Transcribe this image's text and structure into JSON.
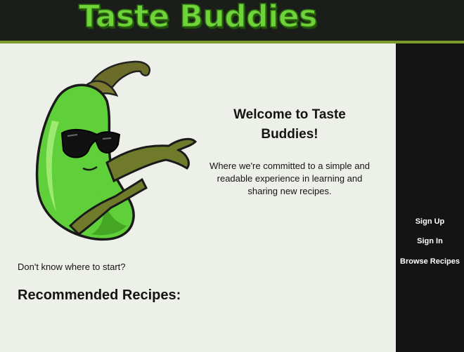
{
  "header": {
    "logo_text": "Taste Buddies"
  },
  "sidebar": {
    "items": [
      {
        "label": "Sign Up"
      },
      {
        "label": "Sign In"
      },
      {
        "label": "Browse Recipes"
      }
    ]
  },
  "hero": {
    "mascot": "cool-pickle-with-sunglasses",
    "title": "Welcome to Taste Buddies!",
    "text": "Where we're committed to a simple and readable experience in learning and sharing new recipes."
  },
  "main": {
    "start_prompt": "Don't know where to start?",
    "recommended_heading": "Recommended Recipes:"
  },
  "colors": {
    "header_bg": "#1b1d1a",
    "header_border": "#7a9a2a",
    "logo_green": "#6fd43a",
    "page_bg": "#edefe9",
    "sidebar_bg": "#141414"
  }
}
